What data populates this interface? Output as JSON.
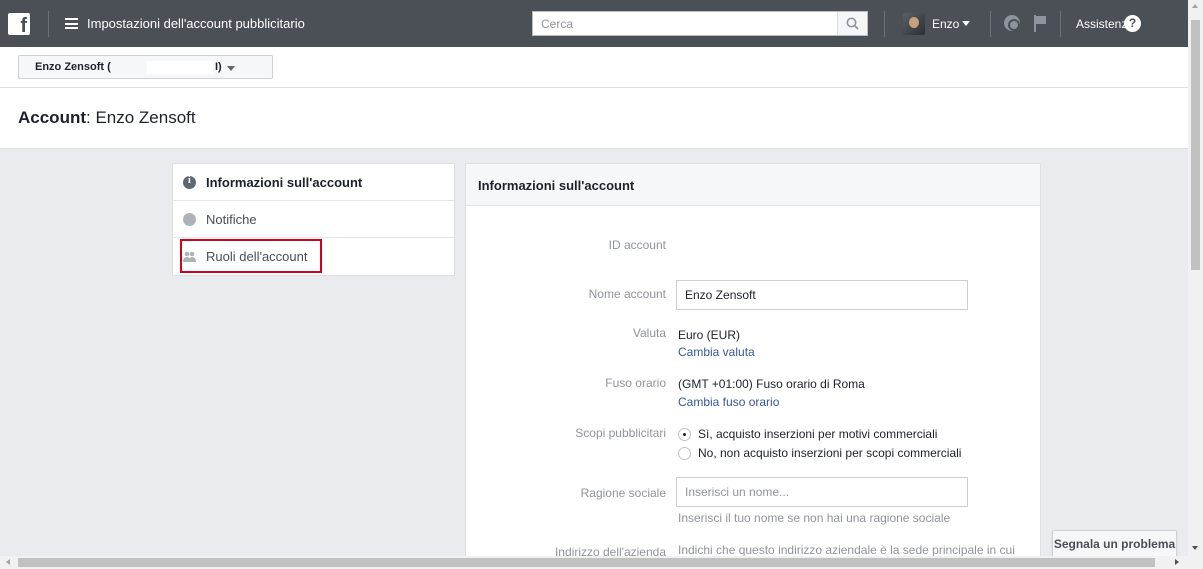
{
  "topbar": {
    "logo": "f",
    "menu_icon": "hamburger-icon",
    "title": "Impostazioni dell'account pubblicitario",
    "search_placeholder": "Cerca",
    "user_name": "Enzo",
    "help_label": "Assistenza",
    "help_icon": "?",
    "bar_color": "#4b4f56"
  },
  "account_selector": {
    "label": "Enzo Zensoft (",
    "label_tail": "I)"
  },
  "page": {
    "title_prefix": "Account",
    "title_suffix": ": Enzo Zensoft"
  },
  "sidebar": {
    "items": [
      {
        "label": "Informazioni sull'account",
        "icon": "info-icon",
        "active": true
      },
      {
        "label": "Notifiche",
        "icon": "globe-icon",
        "active": false
      },
      {
        "label": "Ruoli dell'account",
        "icon": "people-icon",
        "active": false,
        "highlighted": true
      }
    ],
    "highlight_color": "#d0021b"
  },
  "panel": {
    "title": "Informazioni sull'account",
    "id_label": "ID account",
    "name_label": "Nome account",
    "name_value": "Enzo Zensoft",
    "currency_label": "Valuta",
    "currency_value": "Euro (EUR)",
    "currency_link": "Cambia valuta",
    "timezone_label": "Fuso orario",
    "timezone_value": "(GMT +01:00) Fuso orario di Roma",
    "timezone_link": "Cambia fuso orario",
    "purpose_label": "Scopi pubblicitari",
    "purpose_options": [
      {
        "label": "Sì, acquisto inserzioni per motivi commerciali",
        "checked": true
      },
      {
        "label": "No, non acquisto inserzioni per scopi commerciali",
        "checked": false
      }
    ],
    "company_label": "Ragione sociale",
    "company_placeholder": "Inserisci un nome...",
    "company_help": "Inserisci il tuo nome se non hai una ragione sociale",
    "address_label": "Indirizzo dell'azienda",
    "address_help": "Indichi che questo indirizzo aziendale è la sede principale in cui"
  },
  "report_button": "Segnala un problema",
  "link_color": "#365899"
}
